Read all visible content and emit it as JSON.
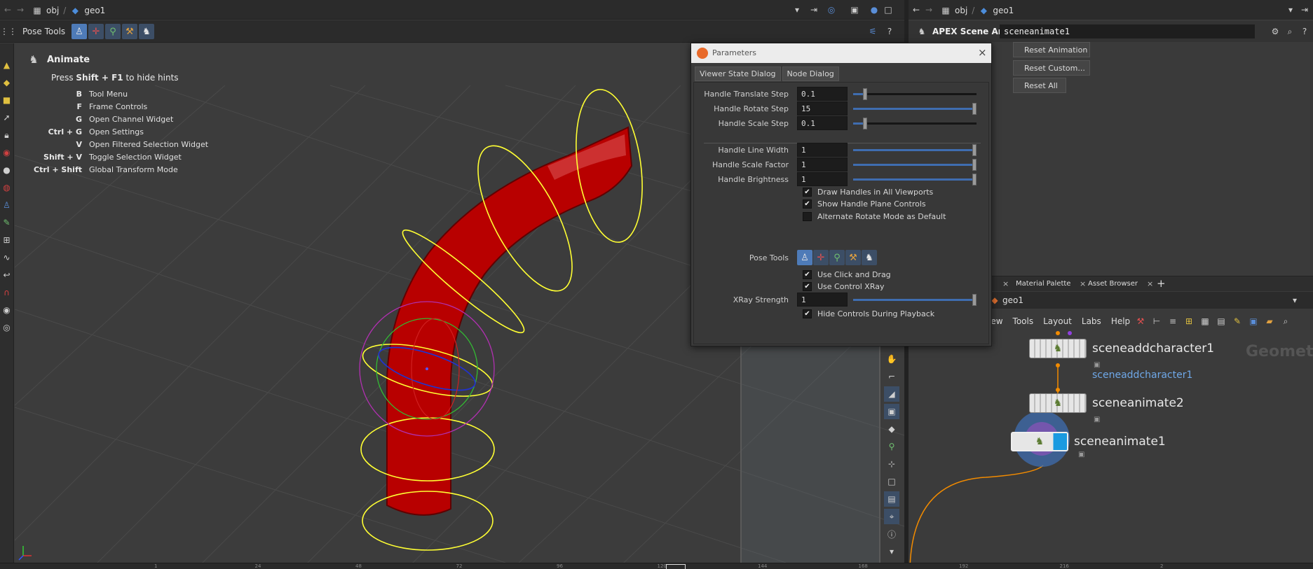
{
  "left_pane": {
    "path": [
      "obj",
      "geo1"
    ],
    "toolbar_label": "Pose Tools"
  },
  "right_pane": {
    "path": [
      "obj",
      "geo1"
    ],
    "node_type": "APEX Scene Animate",
    "node_name": "sceneanimate1",
    "buttons": [
      "Reset Animation",
      "Reset Custom...",
      "Reset All"
    ]
  },
  "hints": {
    "title": "Animate",
    "press_prefix": "Press ",
    "press_key": "Shift + F1",
    "press_suffix": " to hide hints",
    "rows": [
      {
        "key": "B",
        "action": "Tool Menu"
      },
      {
        "key": "F",
        "action": "Frame Controls"
      },
      {
        "key": "G",
        "action": "Open Channel Widget"
      },
      {
        "key": "Ctrl + G",
        "action": "Open Settings"
      },
      {
        "key": "V",
        "action": "Open Filtered Selection Widget"
      },
      {
        "key": "Shift + V",
        "action": "Toggle Selection Widget"
      },
      {
        "key": "Ctrl + Shift",
        "action": "Global Transform Mode"
      }
    ]
  },
  "params": {
    "title": "Parameters",
    "tabs": [
      "Viewer State Dialog",
      "Node Dialog"
    ],
    "rows": [
      {
        "label": "Handle Translate Step",
        "value": "0.1",
        "fill": 0.08
      },
      {
        "label": "Handle Rotate Step",
        "value": "15",
        "fill": 1.0
      },
      {
        "label": "Handle Scale Step",
        "value": "0.1",
        "fill": 0.08
      },
      {
        "label": "Handle Line Width",
        "value": "1",
        "fill": 1.0
      },
      {
        "label": "Handle Scale Factor",
        "value": "1",
        "fill": 1.0
      },
      {
        "label": "Handle Brightness",
        "value": "1",
        "fill": 1.0
      }
    ],
    "checks_a": [
      {
        "label": "Draw Handles in All Viewports",
        "checked": true
      },
      {
        "label": "Show Handle Plane Controls",
        "checked": true
      },
      {
        "label": "Alternate Rotate Mode as Default",
        "checked": false
      }
    ],
    "pose_tools_label": "Pose Tools",
    "checks_b": [
      {
        "label": "Use Click and Drag",
        "checked": true
      },
      {
        "label": "Use Control XRay",
        "checked": true
      }
    ],
    "xray": {
      "label": "XRay Strength",
      "value": "1",
      "fill": 1.0
    },
    "checks_c": [
      {
        "label": "Hide Controls During Playback",
        "checked": true
      }
    ]
  },
  "network": {
    "tabs": [
      "Material Palette",
      "Asset Browser"
    ],
    "path": "geo1",
    "menu": [
      "iew",
      "Tools",
      "Layout",
      "Labs",
      "Help"
    ],
    "watermark": "Geometr",
    "nodes": [
      {
        "name": "sceneaddcharacter1",
        "comment": "sceneaddcharacter1"
      },
      {
        "name": "sceneanimate2"
      },
      {
        "name": "sceneanimate1"
      }
    ]
  },
  "timeline_ticks": [
    "1",
    "24",
    "48",
    "72",
    "96",
    "120",
    "144",
    "168",
    "192",
    "216",
    "2"
  ],
  "colors": {
    "accent": "#3f6db0",
    "tube": "#c00000",
    "handle": "#ffff33",
    "wire": "#f28b00"
  }
}
